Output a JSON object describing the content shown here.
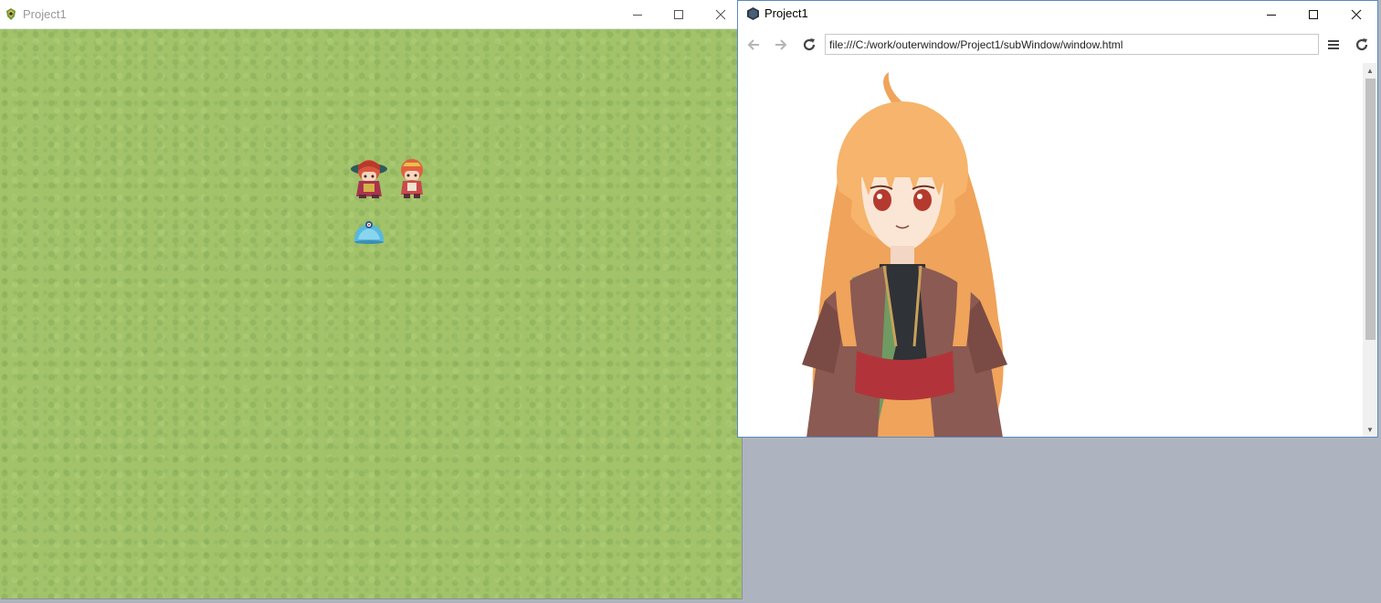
{
  "game_window": {
    "title": "Project1",
    "icon": "rpg-maker-icon",
    "controls": {
      "minimize": "minimize-icon",
      "maximize": "maximize-icon",
      "close": "close-icon"
    },
    "field": {
      "background": "grass",
      "sprites": [
        "hero-sprite",
        "party-member-sprite",
        "slime-monster-sprite"
      ]
    }
  },
  "browser_window": {
    "title": "Project1",
    "icon": "nwjs-icon",
    "controls": {
      "minimize": "minimize-icon",
      "maximize": "maximize-icon",
      "close": "close-icon"
    },
    "nav": {
      "back_icon": "arrow-left-icon",
      "forward_icon": "arrow-right-icon",
      "reload_icon": "reload-icon",
      "url": "file:///C:/work/outerwindow/Project1/subWindow/window.html",
      "menu_icon": "hamburger-menu-icon",
      "right_reload_icon": "reload-icon"
    },
    "content": {
      "image": "anime-girl-character-illustration"
    }
  },
  "colors": {
    "desktop": "#aeb4bf",
    "grass": "#a2c36a",
    "browser_border": "#5b88c2",
    "hair": "#f3a85c",
    "robe": "#8b5a52",
    "sash": "#b2343a",
    "green_robe": "#6f9b62"
  }
}
